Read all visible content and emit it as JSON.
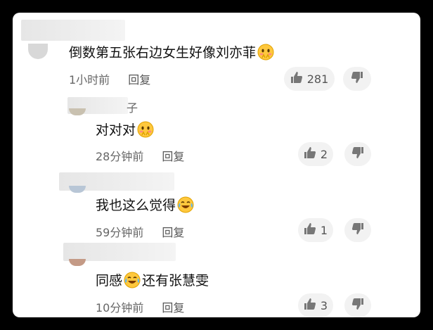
{
  "comments": [
    {
      "text": "倒数第五张右边女生好像刘亦菲",
      "emoji": "shy-face-emoji",
      "time": "1小时前",
      "reply_label": "回复",
      "likes": "281"
    },
    {
      "username_fragment": "子",
      "text": "对对对",
      "emoji": "shy-face-emoji",
      "time": "28分钟前",
      "reply_label": "回复",
      "likes": "2"
    },
    {
      "text": "我也这么觉得",
      "emoji": "laugh-cry-emoji",
      "time": "59分钟前",
      "reply_label": "回复",
      "likes": "1"
    },
    {
      "text_before": "同感",
      "emoji": "laugh-cry-emoji",
      "text_after": "还有张慧雯",
      "time": "10分钟前",
      "reply_label": "回复",
      "likes": "3"
    }
  ],
  "icons": {
    "like": "thumbs-up-icon",
    "dislike": "thumbs-down-icon"
  },
  "colors": {
    "background": "#000000",
    "card": "#ffffff",
    "pill": "#f2f2f2",
    "text": "#111111",
    "meta": "#666666"
  }
}
